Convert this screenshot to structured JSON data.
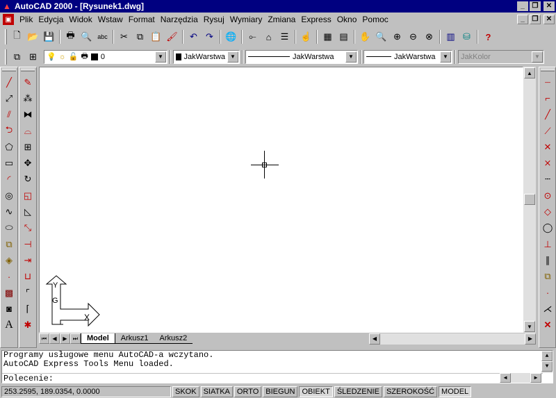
{
  "window": {
    "title": "AutoCAD 2000 - [Rysunek1.dwg]",
    "app_icon": "autocad-logo-icon"
  },
  "menu": {
    "items": [
      "Plik",
      "Edycja",
      "Widok",
      "Wstaw",
      "Format",
      "Narzędzia",
      "Rysuj",
      "Wymiary",
      "Zmiana",
      "Express",
      "Okno",
      "Pomoc"
    ]
  },
  "standard_toolbar": {
    "icons": [
      "new-file-icon",
      "open-file-icon",
      "save-icon",
      "print-icon",
      "print-preview-icon",
      "spell-check-icon",
      "cut-icon",
      "copy-icon",
      "paste-icon",
      "match-properties-icon",
      "undo-icon",
      "redo-icon",
      "internet-icon",
      "snap-tracking-icon",
      "ucs-icon",
      "named-views-icon",
      "pick-icon",
      "design-center-icon",
      "properties-icon",
      "pan-realtime-icon",
      "zoom-realtime-icon",
      "zoom-window-icon",
      "zoom-previous-icon",
      "aerial-view-icon",
      "distance-icon",
      "database-icon",
      "help-icon"
    ]
  },
  "properties_toolbar": {
    "layer_value": "0",
    "color_value": "JakWarstwa",
    "linetype_value": "JakWarstwa",
    "lineweight_value": "JakWarstwa",
    "plotstyle_value": "JakKolor"
  },
  "draw_toolbar": {
    "icons": [
      "line-icon",
      "construction-line-icon",
      "multiline-icon",
      "polyline-icon",
      "polygon-icon",
      "rectangle-icon",
      "arc-icon",
      "circle-icon",
      "spline-icon",
      "ellipse-icon",
      "insert-block-icon",
      "make-block-icon",
      "point-icon",
      "hatch-icon",
      "region-icon",
      "text-icon"
    ]
  },
  "modify_toolbar": {
    "icons": [
      "erase-icon",
      "copy-object-icon",
      "mirror-icon",
      "offset-icon",
      "array-icon",
      "move-icon",
      "rotate-icon",
      "scale-icon",
      "stretch-icon",
      "lengthen-icon",
      "trim-icon",
      "extend-icon",
      "break-icon",
      "chamfer-icon",
      "fillet-icon",
      "explode-icon"
    ]
  },
  "osnap_toolbar": {
    "icons": [
      "temporary-tracking-icon",
      "snap-from-icon",
      "snap-endpoint-icon",
      "snap-midpoint-icon",
      "snap-intersection-icon",
      "snap-apparent-intersection-icon",
      "snap-extension-icon",
      "snap-center-icon",
      "snap-quadrant-icon",
      "snap-tangent-icon",
      "snap-perpendicular-icon",
      "snap-parallel-icon",
      "snap-insert-icon",
      "snap-node-icon",
      "snap-nearest-icon",
      "snap-none-icon"
    ]
  },
  "ucs_icon": {
    "x_label": "X",
    "y_label": "Y",
    "w_label": "G"
  },
  "tabs": [
    "Model",
    "Arkusz1",
    "Arkusz2"
  ],
  "command_window": {
    "lines": [
      "Programy usługowe menu AutoCAD-a wczytano.",
      "AutoCAD Express Tools Menu loaded."
    ],
    "prompt": "Polecenie:"
  },
  "status_bar": {
    "coordinates": "253.2595, 189.0354, 0.0000",
    "toggles": [
      "SKOK",
      "SIATKA",
      "ORTO",
      "BIEGUN",
      "OBIEKT",
      "ŚLEDZENIE",
      "SZEROKOŚĆ",
      "MODEL"
    ]
  }
}
